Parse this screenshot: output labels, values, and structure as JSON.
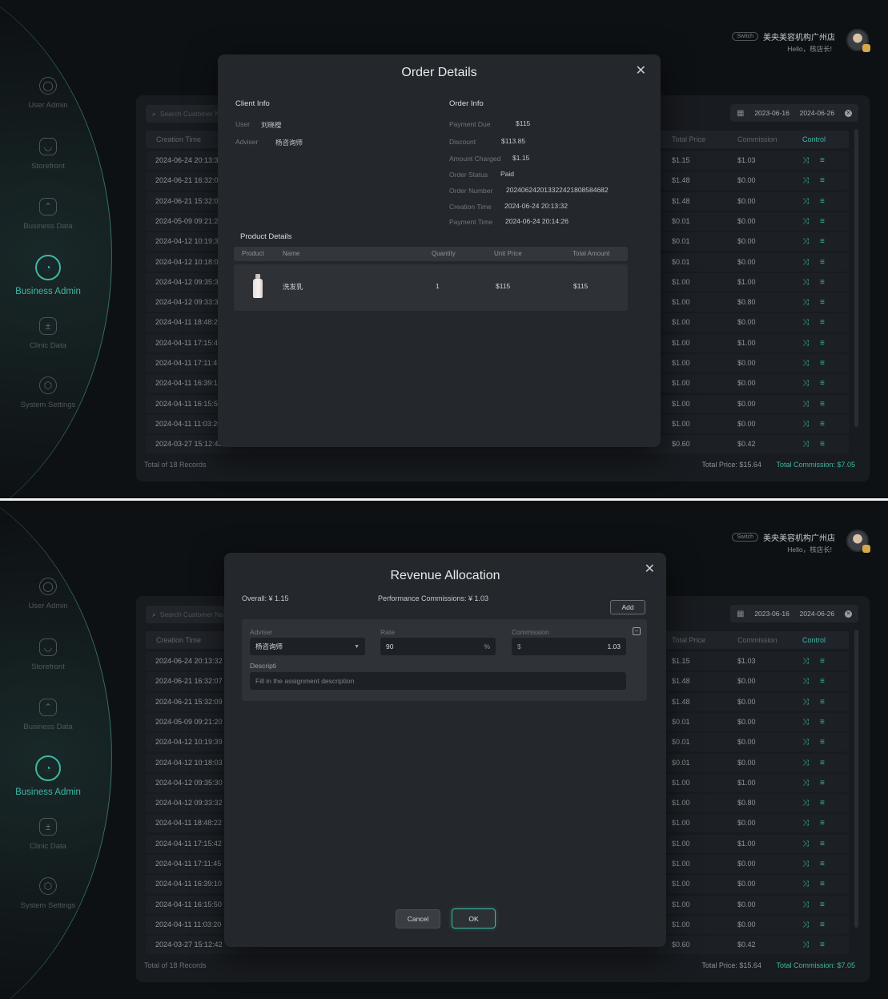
{
  "sidebar": {
    "items": [
      {
        "label": "User Admin",
        "icon": "user-icon"
      },
      {
        "label": "Storefront",
        "icon": "storefront-icon"
      },
      {
        "label": "Business Data",
        "icon": "chart-icon"
      },
      {
        "label": "Business Admin",
        "icon": "pie-chart-icon",
        "active": true
      },
      {
        "label": "Clinic Data",
        "icon": "clinic-icon"
      },
      {
        "label": "System Settings",
        "icon": "settings-icon"
      }
    ]
  },
  "header": {
    "switch_label": "Switch",
    "store_name": "美央美容机构广州店",
    "greeting": "Hello，核店长!"
  },
  "filters": {
    "search_placeholder": "Search Customer Na",
    "date_start": "2023-06-16",
    "date_end": "2024-06-26"
  },
  "table": {
    "headers": {
      "creation_time": "Creation Time",
      "total_price": "Total Price",
      "commission": "Commission",
      "control": "Control"
    },
    "rows": [
      {
        "time": "2024-06-24 20:13:32",
        "price": "$1.15",
        "commission": "$1.03"
      },
      {
        "time": "2024-06-21 16:32:07",
        "price": "$1.48",
        "commission": "$0.00"
      },
      {
        "time": "2024-06-21 15:32:09",
        "price": "$1.48",
        "commission": "$0.00"
      },
      {
        "time": "2024-05-09 09:21:20",
        "price": "$0.01",
        "commission": "$0.00"
      },
      {
        "time": "2024-04-12 10:19:39",
        "price": "$0.01",
        "commission": "$0.00"
      },
      {
        "time": "2024-04-12 10:18:03",
        "price": "$0.01",
        "commission": "$0.00"
      },
      {
        "time": "2024-04-12 09:35:30",
        "price": "$1.00",
        "commission": "$1.00"
      },
      {
        "time": "2024-04-12 09:33:32",
        "price": "$1.00",
        "commission": "$0.80"
      },
      {
        "time": "2024-04-11 18:48:22",
        "price": "$1.00",
        "commission": "$0.00"
      },
      {
        "time": "2024-04-11 17:15:42",
        "price": "$1.00",
        "commission": "$1.00"
      },
      {
        "time": "2024-04-11 17:11:45",
        "price": "$1.00",
        "commission": "$0.00"
      },
      {
        "time": "2024-04-11 16:39:10",
        "price": "$1.00",
        "commission": "$0.00"
      },
      {
        "time": "2024-04-11 16:15:50",
        "price": "$1.00",
        "commission": "$0.00"
      },
      {
        "time": "2024-04-11 11:03:20",
        "price": "$1.00",
        "commission": "$0.00"
      },
      {
        "time": "2024-03-27 15:12:42",
        "price": "$0.60",
        "commission": "$0.42"
      }
    ],
    "control_icons": [
      "split-icon",
      "list-icon"
    ],
    "control_glyphs": [
      "⤨",
      "≡"
    ]
  },
  "footer": {
    "records": "Total of 18 Records",
    "total_price": "Total Price:  $15.64",
    "total_commission": "Total Commission:  $7.05"
  },
  "order_modal": {
    "title": "Order Details",
    "client_info_title": "Client Info",
    "user_label": "User",
    "user_value": "刘晓橙",
    "adviser_label": "Adviser",
    "adviser_value": "杨咨询师",
    "order_info_title": "Order Info",
    "fields": [
      {
        "label": "Payment Due",
        "value": "$115"
      },
      {
        "label": "Discount",
        "value": "$113.85"
      },
      {
        "label": "Amount Charged",
        "value": "$1.15"
      },
      {
        "label": "Order Status",
        "value": "Paid"
      },
      {
        "label": "Order Number",
        "value": "20240624201332242180858468​2"
      },
      {
        "label": "Creation Time",
        "value": "2024-06-24 20:13:32"
      },
      {
        "label": "Payment Time",
        "value": "2024-06-24 20:14:26"
      }
    ],
    "product_details_title": "Product Details",
    "product_headers": {
      "product": "Product",
      "name": "Name",
      "quantity": "Quantity",
      "unit_price": "Unit Price",
      "total_amount": "Total Amount"
    },
    "product": {
      "name": "洗发乳",
      "quantity": "1",
      "unit_price": "$115",
      "total_amount": "$115"
    }
  },
  "alloc_modal": {
    "title": "Revenue Allocation",
    "overall": "Overall:   ¥ 1.15",
    "performance": "Performance Commissions:  ¥ 1.03",
    "add_label": "Add",
    "adviser_label": "Adviser",
    "adviser_value": "杨咨询师",
    "rate_label": "Rate",
    "rate_value": "90",
    "rate_suffix": "%",
    "commission_label": "Commission",
    "commission_prefix": "$",
    "commission_value": "1.03",
    "description_label": "Descripti",
    "description_placeholder": "Fill in the assignment description",
    "cancel_label": "Cancel",
    "ok_label": "OK"
  },
  "colors": {
    "accent": "#3fb6a4",
    "background": "#0e1114",
    "card": "#181b1f",
    "modal": "#24272b"
  }
}
